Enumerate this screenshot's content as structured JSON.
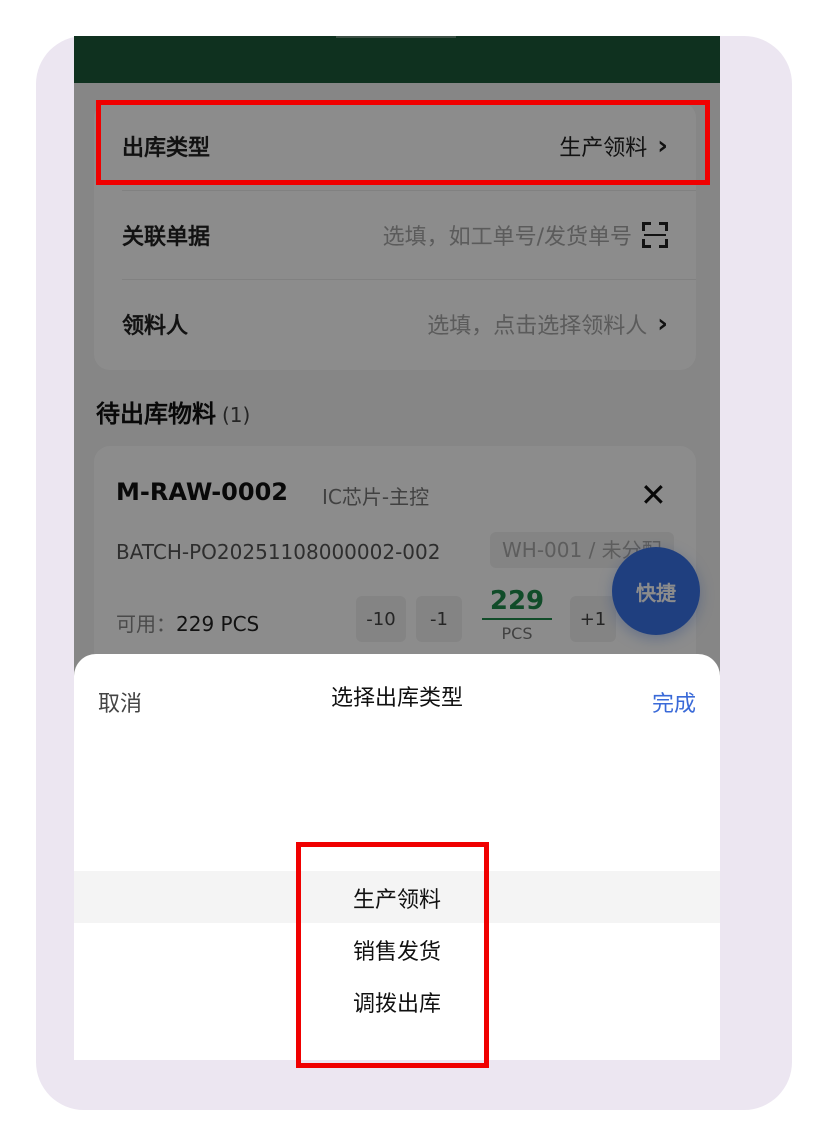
{
  "form": {
    "out_type_label": "出库类型",
    "out_type_value": "生产领料",
    "related_doc_label": "关联单据",
    "related_doc_placeholder": "选填，如工单号/发货单号",
    "receiver_label": "领料人",
    "receiver_placeholder": "选填，点击选择领料人"
  },
  "materials": {
    "title": "待出库物料",
    "count": "(1)",
    "item": {
      "code": "M-RAW-0002",
      "name": "IC芯片-主控",
      "batch": "BATCH-PO20251108000002-002",
      "warehouse": "WH-001 / 未分配",
      "available_label": "可用：",
      "available_value": "229 PCS",
      "minus10": "-10",
      "minus1": "-1",
      "plus1": "+1",
      "qty": "229",
      "unit": "PCS"
    }
  },
  "fab_label": "快捷",
  "sheet": {
    "cancel": "取消",
    "title": "选择出库类型",
    "done": "完成",
    "options": [
      "生产领料",
      "销售发货",
      "调拨出库"
    ]
  },
  "colors": {
    "header_green": "#1d5a3a",
    "accent_blue": "#3a74e8",
    "qty_green": "#1f8a4c",
    "highlight_red": "#f00000"
  }
}
